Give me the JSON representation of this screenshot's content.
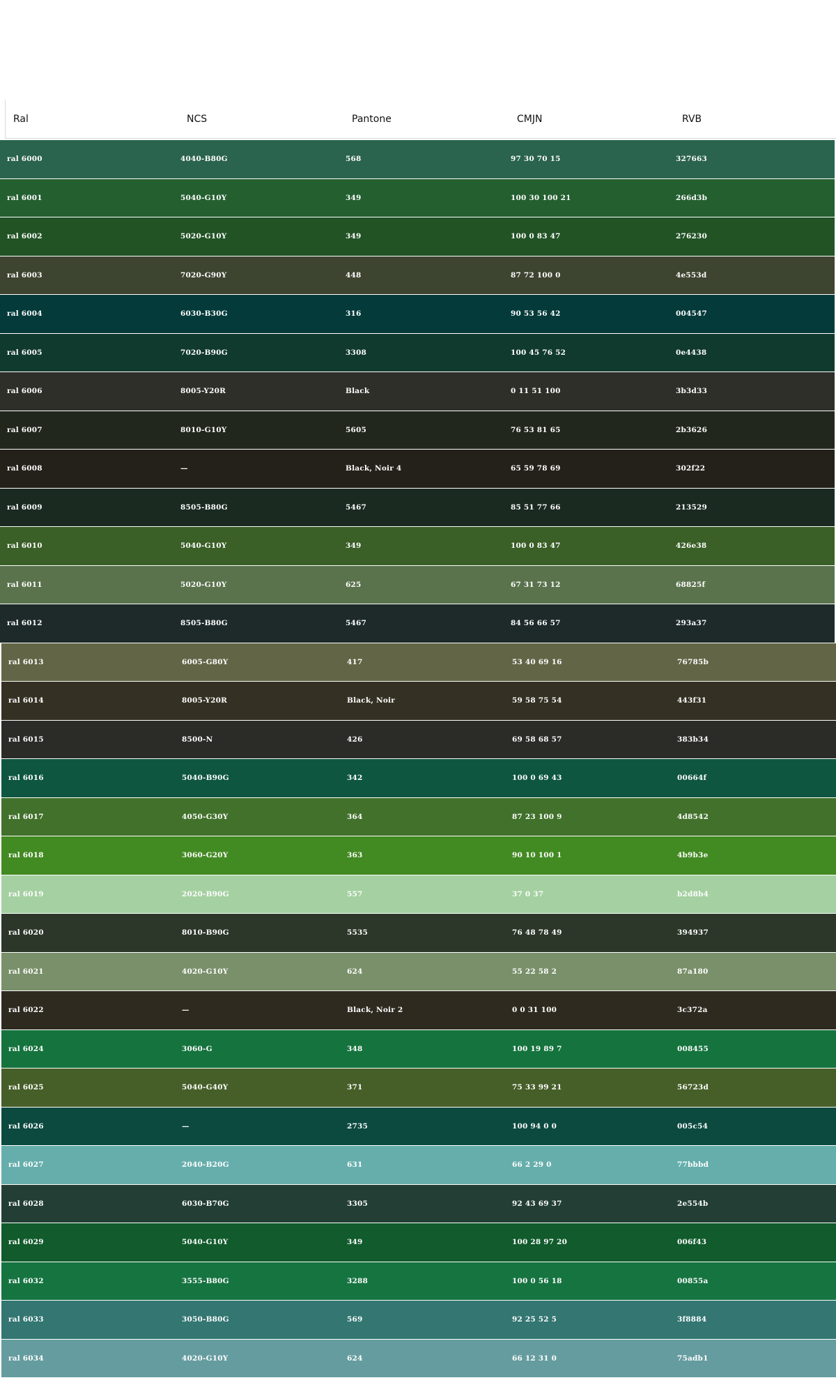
{
  "table": {
    "headers": [
      "Ral",
      "NCS",
      "Pantone",
      "CMJN",
      "RVB"
    ],
    "rows": [
      {
        "ral": "ral 6000",
        "ncs": "4040-B80G",
        "pantone": "568",
        "cmjn": "97 30 70 15",
        "rvb": "327663",
        "bg": "#2a634e"
      },
      {
        "ral": "ral 6001",
        "ncs": "5040-G10Y",
        "pantone": "349",
        "cmjn": "100 30 100 21",
        "rvb": "266d3b",
        "bg": "#245f30"
      },
      {
        "ral": "ral 6002",
        "ncs": "5020-G10Y",
        "pantone": "349",
        "cmjn": "100 0 83 47",
        "rvb": "276230",
        "bg": "#225325"
      },
      {
        "ral": "ral 6003",
        "ncs": "7020-G90Y",
        "pantone": "448",
        "cmjn": "87 72 100 0",
        "rvb": "4e553d",
        "bg": "#3d4430"
      },
      {
        "ral": "ral 6004",
        "ncs": "6030-B30G",
        "pantone": "316",
        "cmjn": "90 53 56 42",
        "rvb": "004547",
        "bg": "#043a3a"
      },
      {
        "ral": "ral 6005",
        "ncs": "7020-B90G",
        "pantone": "3308",
        "cmjn": "100 45 76 52",
        "rvb": "0e4438",
        "bg": "#113a2e"
      },
      {
        "ral": "ral 6006",
        "ncs": "8005-Y20R",
        "pantone": "Black",
        "cmjn": "0 11 51 100",
        "rvb": "3b3d33",
        "bg": "#2f2f2a"
      },
      {
        "ral": "ral 6007",
        "ncs": "8010-G10Y",
        "pantone": "5605",
        "cmjn": "76 53 81 65",
        "rvb": "2b3626",
        "bg": "#21271d"
      },
      {
        "ral": "ral 6008",
        "ncs": "—",
        "pantone": "Black, Noir 4",
        "cmjn": "65 59 78 69",
        "rvb": "302f22",
        "bg": "#23211a"
      },
      {
        "ral": "ral 6009",
        "ncs": "8505-B80G",
        "pantone": "5467",
        "cmjn": "85 51 77 66",
        "rvb": "213529",
        "bg": "#1a2a21"
      },
      {
        "ral": "ral 6010",
        "ncs": "5040-G10Y",
        "pantone": "349",
        "cmjn": "100 0 83 47",
        "rvb": "426e38",
        "bg": "#3a5f27"
      },
      {
        "ral": "ral 6011",
        "ncs": "5020-G10Y",
        "pantone": "625",
        "cmjn": "67 31 73 12",
        "rvb": "68825f",
        "bg": "#5a734d"
      },
      {
        "ral": "ral 6012",
        "ncs": "8505-B80G",
        "pantone": "5467",
        "cmjn": "84 56 66 57",
        "rvb": "293a37",
        "bg": "#1e2a2a"
      },
      {
        "ral": "ral 6013",
        "ncs": "6005-G80Y",
        "pantone": "417",
        "cmjn": "53 40 69 16",
        "rvb": "76785b",
        "bg": "#626646"
      },
      {
        "ral": "ral 6014",
        "ncs": "8005-Y20R",
        "pantone": "Black, Noir",
        "cmjn": "59 58 75 54",
        "rvb": "443f31",
        "bg": "#353024"
      },
      {
        "ral": "ral 6015",
        "ncs": "8500-N",
        "pantone": "426",
        "cmjn": "69 58 68 57",
        "rvb": "383b34",
        "bg": "#2b2c28"
      },
      {
        "ral": "ral 6016",
        "ncs": "5040-B90G",
        "pantone": "342",
        "cmjn": "100 0 69 43",
        "rvb": "00664f",
        "bg": "#0e563f"
      },
      {
        "ral": "ral 6017",
        "ncs": "4050-G30Y",
        "pantone": "364",
        "cmjn": "87 23 100 9",
        "rvb": "4d8542",
        "bg": "#41712b"
      },
      {
        "ral": "ral 6018",
        "ncs": "3060-G20Y",
        "pantone": "363",
        "cmjn": "90 10 100 1",
        "rvb": "4b9b3e",
        "bg": "#428a22"
      },
      {
        "ral": "ral 6019",
        "ncs": "2020-B90G",
        "pantone": "557",
        "cmjn": "37 0 37",
        "rvb": "b2d8b4",
        "bg": "#a5d0a1"
      },
      {
        "ral": "ral 6020",
        "ncs": "8010-B90G",
        "pantone": "5535",
        "cmjn": "76 48 78 49",
        "rvb": "394937",
        "bg": "#2c3729"
      },
      {
        "ral": "ral 6021",
        "ncs": "4020-G10Y",
        "pantone": "624",
        "cmjn": "55 22 58 2",
        "rvb": "87a180",
        "bg": "#79906a"
      },
      {
        "ral": "ral 6022",
        "ncs": "—",
        "pantone": "Black, Noir 2",
        "cmjn": "0 0 31 100",
        "rvb": "3c372a",
        "bg": "#2e2a20"
      },
      {
        "ral": "ral 6024",
        "ncs": "3060-G",
        "pantone": "348",
        "cmjn": "100 19 89 7",
        "rvb": "008455",
        "bg": "#15733d"
      },
      {
        "ral": "ral 6025",
        "ncs": "5040-G40Y",
        "pantone": "371",
        "cmjn": "75 33 99 21",
        "rvb": "56723d",
        "bg": "#465f29"
      },
      {
        "ral": "ral 6026",
        "ncs": "—",
        "pantone": "2735",
        "cmjn": "100 94 0 0",
        "rvb": "005c54",
        "bg": "#0c4a40"
      },
      {
        "ral": "ral 6027",
        "ncs": "2040-B20G",
        "pantone": "631",
        "cmjn": "66 2 29 0",
        "rvb": "77bbbd",
        "bg": "#65aeac"
      },
      {
        "ral": "ral 6028",
        "ncs": "6030-B70G",
        "pantone": "3305",
        "cmjn": "92 43 69 37",
        "rvb": "2e554b",
        "bg": "#233f35"
      },
      {
        "ral": "ral 6029",
        "ncs": "5040-G10Y",
        "pantone": "349",
        "cmjn": "100 28 97 20",
        "rvb": "006f43",
        "bg": "#115b2c"
      },
      {
        "ral": "ral 6032",
        "ncs": "3555-B80G",
        "pantone": "3288",
        "cmjn": "100 0 56 18",
        "rvb": "00855a",
        "bg": "#167441"
      },
      {
        "ral": "ral 6033",
        "ncs": "3050-B80G",
        "pantone": "569",
        "cmjn": "92 25 52 5",
        "rvb": "3f8884",
        "bg": "#337672"
      },
      {
        "ral": "ral 6034",
        "ncs": "4020-G10Y",
        "pantone": "624",
        "cmjn": "66 12 31 0",
        "rvb": "75adb1",
        "bg": "#659c9f"
      }
    ]
  }
}
